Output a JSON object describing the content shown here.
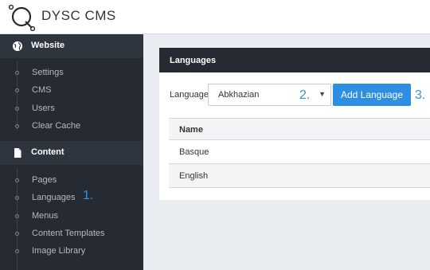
{
  "brand": {
    "name_part1": "DYSC",
    "name_part2": " CMS"
  },
  "sidebar": {
    "sections": [
      {
        "label": "Website",
        "icon": "globe-icon",
        "items": [
          "Settings",
          "CMS",
          "Users",
          "Clear Cache"
        ]
      },
      {
        "label": "Content",
        "icon": "document-icon",
        "items": [
          "Pages",
          "Languages",
          "Menus",
          "Content Templates",
          "Image Library"
        ]
      }
    ]
  },
  "annotations": {
    "step1": "1.",
    "step2": "2.",
    "step3": "3."
  },
  "panel": {
    "title": "Languages",
    "language_label": "Language",
    "language_select_value": "Abkhazian",
    "add_button": "Add Language",
    "table": {
      "header": "Name",
      "rows": [
        "Basque",
        "English"
      ]
    }
  },
  "colors": {
    "accent": "#2d8ee2",
    "sidebar_bg": "#252a33",
    "annotation": "#3391dd"
  }
}
